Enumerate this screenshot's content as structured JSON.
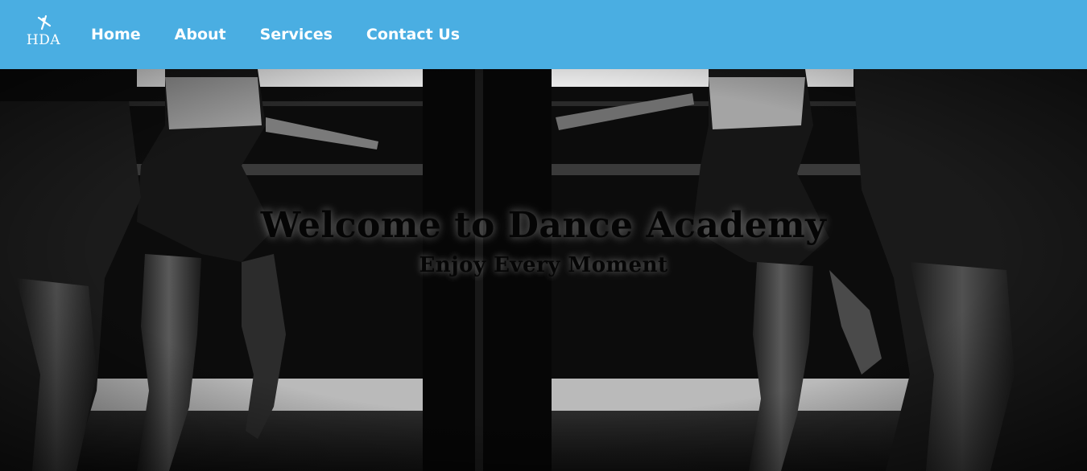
{
  "brand": {
    "logo_text": "HDA",
    "logo_icon": "dancer-icon"
  },
  "nav": {
    "items": [
      {
        "label": "Home"
      },
      {
        "label": "About"
      },
      {
        "label": "Services"
      },
      {
        "label": "Contact Us"
      }
    ]
  },
  "hero": {
    "title": "Welcome to Dance Academy",
    "subtitle": "Enjoy Every Moment",
    "background": "black-and-white photo of ballet dancers at a barre"
  },
  "colors": {
    "navbar": "#4aaee2",
    "nav_text": "#ffffff",
    "hero_text": "#050505"
  }
}
